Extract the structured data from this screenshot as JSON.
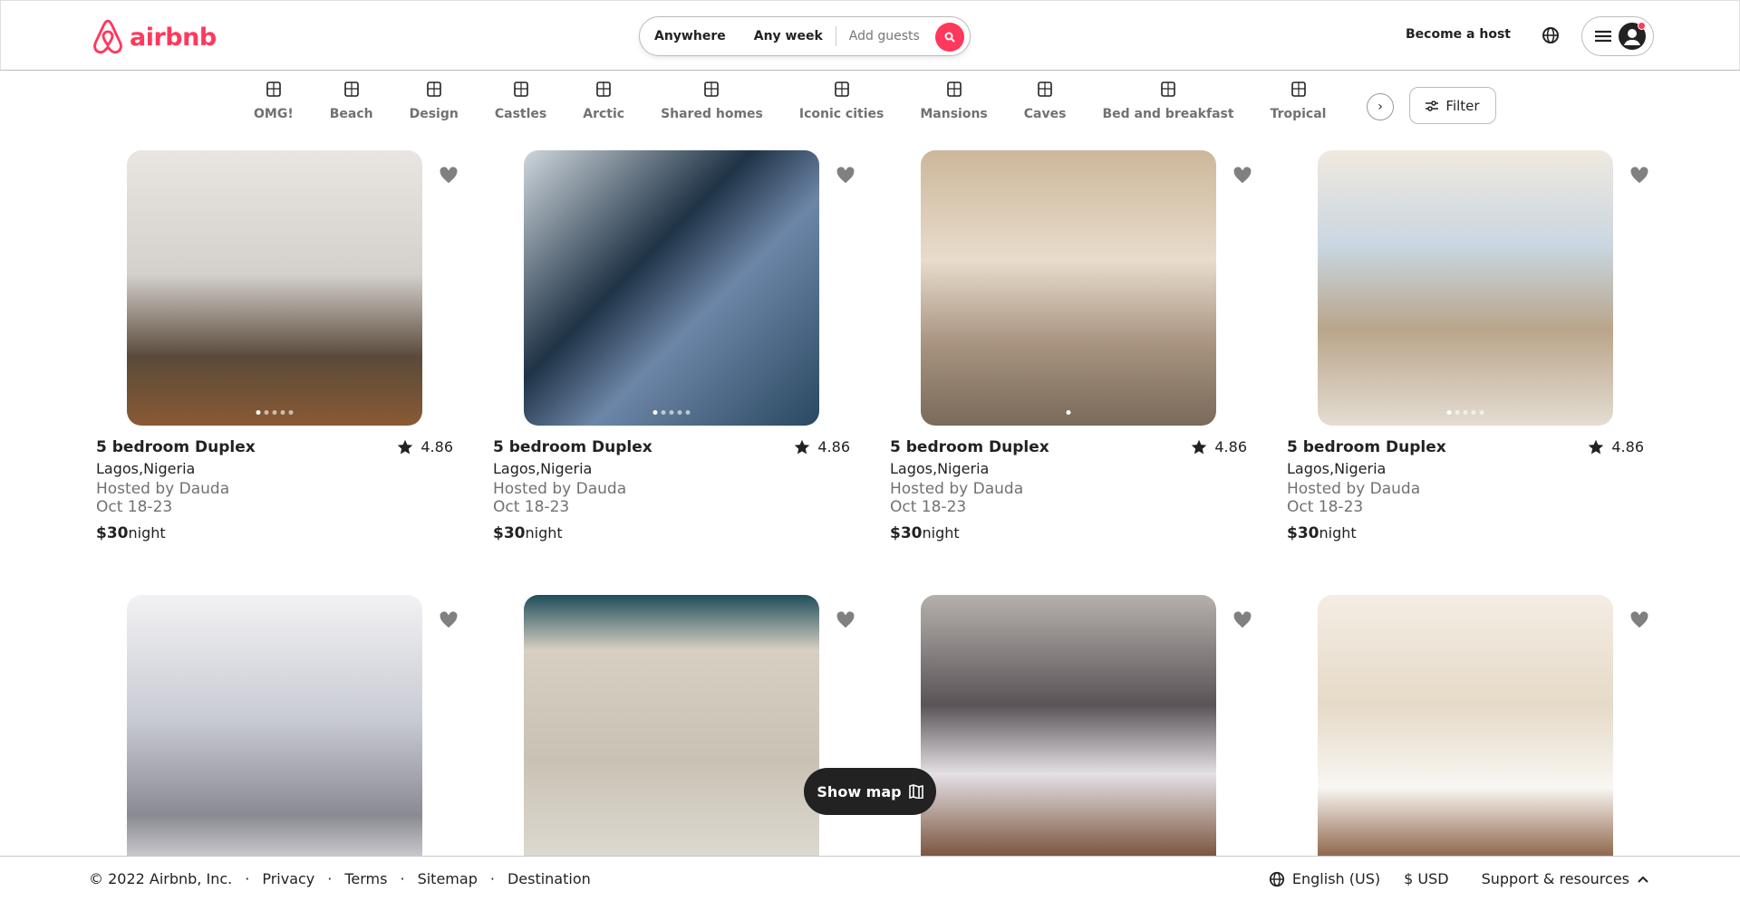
{
  "header": {
    "logo_text": "airbnb",
    "search": {
      "where": "Anywhere",
      "when": "Any week",
      "guests_placeholder": "Add guests"
    },
    "become_host": "Become a host"
  },
  "colors": {
    "brand": "#ff385c"
  },
  "categories": [
    {
      "label": "OMG!",
      "icon": "ufo-icon"
    },
    {
      "label": "Beach",
      "icon": "umbrella-icon"
    },
    {
      "label": "Design",
      "icon": "building-icon"
    },
    {
      "label": "Castles",
      "icon": "castle-icon"
    },
    {
      "label": "Arctic",
      "icon": "snowflake-icon"
    },
    {
      "label": "Shared homes",
      "icon": "house-icon"
    },
    {
      "label": "Iconic cities",
      "icon": "tower-icon"
    },
    {
      "label": "Mansions",
      "icon": "mansion-icon"
    },
    {
      "label": "Caves",
      "icon": "cave-icon"
    },
    {
      "label": "Bed and breakfast",
      "icon": "coffee-icon"
    },
    {
      "label": "Tropical",
      "icon": "palm-icon"
    }
  ],
  "filter_label": "Filter",
  "listings": [
    {
      "title": "5 bedroom Duplex",
      "rating": "4.86",
      "location": "Lagos,Nigeria",
      "host": "Hosted by Dauda",
      "dates": "Oct 18-23",
      "price": "$30",
      "unit": "night"
    },
    {
      "title": "5 bedroom Duplex",
      "rating": "4.86",
      "location": "Lagos,Nigeria",
      "host": "Hosted by Dauda",
      "dates": "Oct 18-23",
      "price": "$30",
      "unit": "night"
    },
    {
      "title": "5 bedroom Duplex",
      "rating": "4.86",
      "location": "Lagos,Nigeria",
      "host": "Hosted by Dauda",
      "dates": "Oct 18-23",
      "price": "$30",
      "unit": "night"
    },
    {
      "title": "5 bedroom Duplex",
      "rating": "4.86",
      "location": "Lagos,Nigeria",
      "host": "Hosted by Dauda",
      "dates": "Oct 18-23",
      "price": "$30",
      "unit": "night"
    },
    {},
    {},
    {},
    {}
  ],
  "show_map": "Show map",
  "footer": {
    "copyright": "© 2022 Airbnb, Inc.",
    "links": [
      "Privacy",
      "Terms",
      "Sitemap",
      "Destination"
    ],
    "language": "English (US)",
    "currency": "$ USD",
    "support": "Support & resources"
  }
}
